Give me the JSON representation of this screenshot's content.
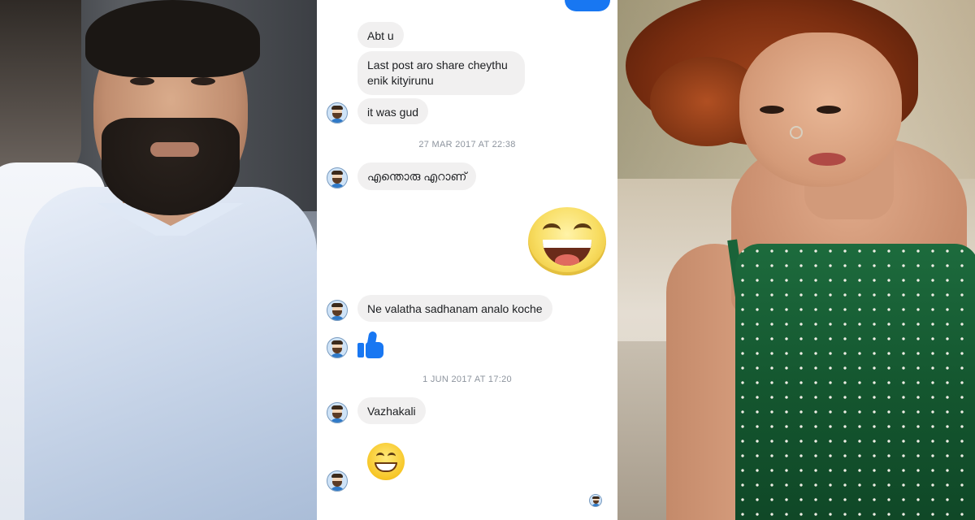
{
  "messages": {
    "m1": "Abt u",
    "m2_line1": "Last post aro share cheythu",
    "m2_line2": "enik kityirunu",
    "m3": "it was gud",
    "ts1": "27 MAR 2017 AT 22:38",
    "m4": "എന്തൊരു എറാണ്",
    "m5": "Ne valatha sadhanam analo koche",
    "ts2": "1 JUN 2017 AT 17:20",
    "m6": "Vazhakali"
  },
  "icons": {
    "avatar": "user-avatar-icon",
    "like": "thumbs-up-icon",
    "emoji_large": "grinning-face-icon",
    "emoji_small": "grinning-face-icon"
  },
  "colors": {
    "incoming_bubble": "#f1f0f0",
    "like_blue": "#1877f2",
    "timestamp": "#8d949e"
  }
}
